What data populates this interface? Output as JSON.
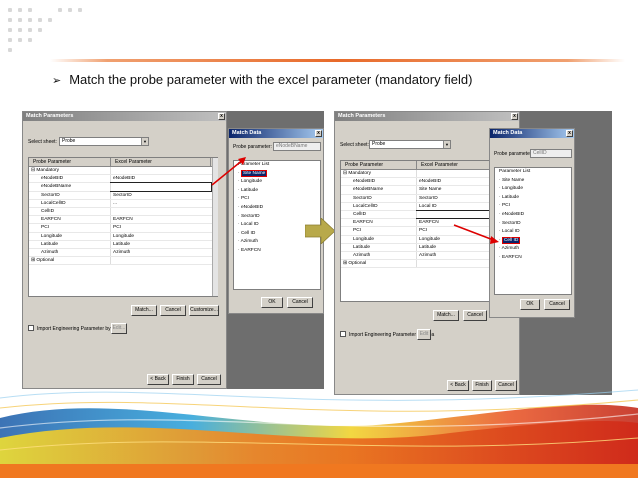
{
  "slide": {
    "bullet_arrow": "➢",
    "bullet_text": "Match the probe parameter with the excel parameter (mandatory field)"
  },
  "left_screen": {
    "main_window": {
      "title": "Match Parameters",
      "close": "x",
      "select_sheet_label": "Select sheet:",
      "select_sheet_value": "Probe",
      "col_probe": "Probe Parameter",
      "col_excel": "Excel Parameter",
      "group_mandatory": "Mandatory",
      "group_optional": "Optional",
      "rows": [
        {
          "probe": "eNodeBID",
          "excel": "eNodeBID"
        },
        {
          "probe": "eNodeBName",
          "excel": ""
        },
        {
          "probe": "SectorID",
          "excel": "SectorID"
        },
        {
          "probe": "LocalCellID",
          "excel": "..."
        },
        {
          "probe": "CellID",
          "excel": ""
        },
        {
          "probe": "EARFCN",
          "excel": "EARFCN"
        },
        {
          "probe": "PCI",
          "excel": "PCI"
        },
        {
          "probe": "Longitude",
          "excel": "Longitude"
        },
        {
          "probe": "Latitude",
          "excel": "Latitude"
        },
        {
          "probe": "Azimuth",
          "excel": "Azimuth"
        }
      ],
      "btn_match": "Match...",
      "btn_cancel": "Cancel",
      "btn_customize": "Customize...",
      "import_label": "Import Engineering Parameter by Area",
      "btn_small": "Edit...",
      "btn_back": "< Back",
      "btn_finish": "Finish",
      "btn_cancel2": "Cancel"
    },
    "match_dialog": {
      "title": "Match Data",
      "close": "x",
      "probe_label": "Probe parameter:",
      "probe_value": "eNodeBName",
      "list_title": "Parameter List",
      "items": [
        "Site Name",
        "Longitude",
        "Latitude",
        "PCI",
        "eNodeBID",
        "SectorID",
        "Local ID",
        "Cell ID",
        "Azimuth",
        "EARFCN"
      ],
      "selected": "Site Name",
      "btn_ok": "OK",
      "btn_cancel": "Cancel"
    }
  },
  "right_screen": {
    "main_window": {
      "title": "Match Parameters",
      "close": "x",
      "select_sheet_label": "Select sheet:",
      "select_sheet_value": "Probe",
      "col_probe": "Probe Parameter",
      "col_excel": "Excel Parameter",
      "group_mandatory": "Mandatory",
      "group_optional": "Optional",
      "rows": [
        {
          "probe": "eNodeBID",
          "excel": "eNodeBID"
        },
        {
          "probe": "eNodeBName",
          "excel": "Site Name"
        },
        {
          "probe": "SectorID",
          "excel": "SectorID"
        },
        {
          "probe": "LocalCellID",
          "excel": "Local ID"
        },
        {
          "probe": "CellID",
          "excel": ""
        },
        {
          "probe": "EARFCN",
          "excel": "EARFCN"
        },
        {
          "probe": "PCI",
          "excel": "PCI"
        },
        {
          "probe": "Longitude",
          "excel": "Longitude"
        },
        {
          "probe": "Latitude",
          "excel": "Latitude"
        },
        {
          "probe": "Azimuth",
          "excel": "Azimuth"
        }
      ],
      "btn_match": "Match...",
      "btn_cancel": "Cancel",
      "import_label": "Import Engineering Parameter by Area",
      "btn_small": "Edit",
      "btn_back": "< Back",
      "btn_finish": "Finish",
      "btn_cancel2": "Cancel"
    },
    "match_dialog": {
      "title": "Match Data",
      "close": "x",
      "probe_label": "Probe parameter:",
      "probe_value": "CellID",
      "list_title": "Parameter List",
      "items": [
        "Site Name",
        "Longitude",
        "Latitude",
        "PCI",
        "eNodeBID",
        "SectorID",
        "Local ID",
        "Cell ID",
        "Azimuth",
        "EARFCN"
      ],
      "selected": "Cell ID",
      "btn_ok": "OK",
      "btn_cancel": "Cancel"
    }
  },
  "colors": {
    "accent_orange": "#f07820",
    "titlebar_blue": "#0a246a",
    "arrow_olive": "#b8a94a",
    "highlight_red": "#dd0000"
  }
}
